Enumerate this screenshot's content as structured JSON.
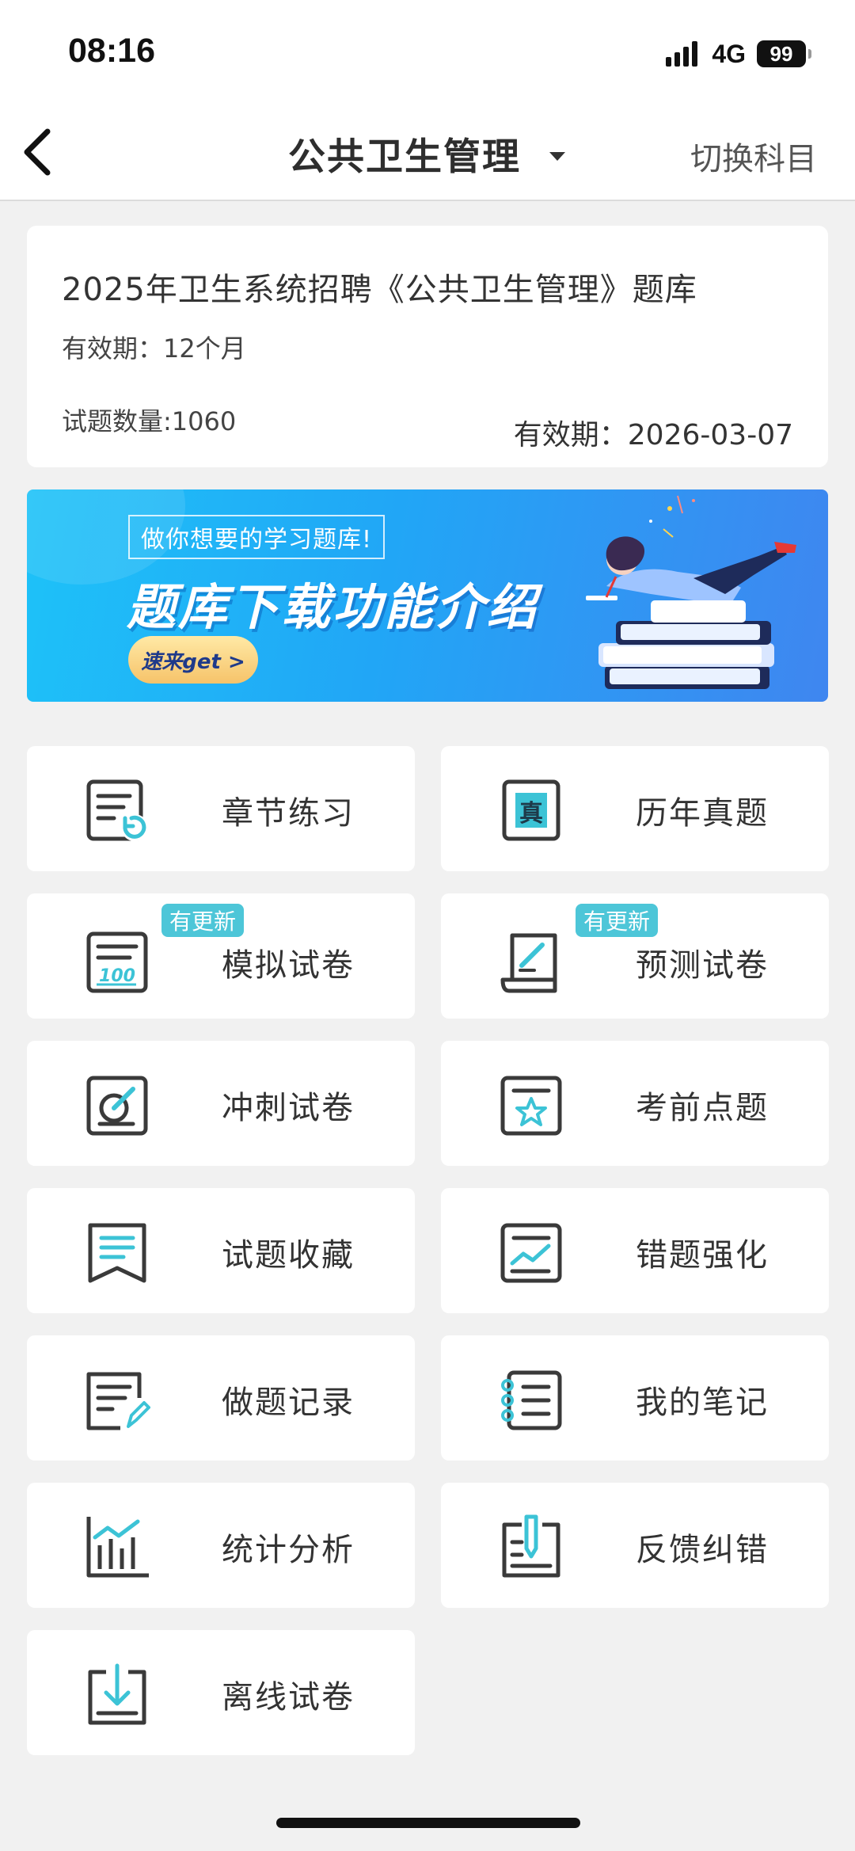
{
  "status": {
    "time": "08:16",
    "network": "4G",
    "battery": "99"
  },
  "nav": {
    "title": "公共卫生管理",
    "switch_label": "切换科目"
  },
  "info": {
    "title": "2025年卫生系统招聘《公共卫生管理》题库",
    "validity": "有效期：12个月",
    "question_count": "试题数量:1060",
    "expire_date": "有效期：2026-03-07"
  },
  "banner": {
    "subtitle": "做你想要的学习题库!",
    "headline": "题库下载功能介绍",
    "button": "速来get >"
  },
  "grid": {
    "badge_label": "有更新",
    "items": [
      {
        "label": "章节练习",
        "icon": "chapter-practice-icon"
      },
      {
        "label": "历年真题",
        "icon": "past-exams-icon"
      },
      {
        "label": "模拟试卷",
        "icon": "mock-paper-icon",
        "badge": true
      },
      {
        "label": "预测试卷",
        "icon": "forecast-paper-icon",
        "badge": true
      },
      {
        "label": "冲刺试卷",
        "icon": "sprint-paper-icon"
      },
      {
        "label": "考前点题",
        "icon": "pre-exam-tips-icon"
      },
      {
        "label": "试题收藏",
        "icon": "bookmark-icon"
      },
      {
        "label": "错题强化",
        "icon": "wrong-questions-icon"
      },
      {
        "label": "做题记录",
        "icon": "practice-record-icon"
      },
      {
        "label": "我的笔记",
        "icon": "notes-icon"
      },
      {
        "label": "统计分析",
        "icon": "statistics-icon"
      },
      {
        "label": "反馈纠错",
        "icon": "feedback-icon"
      },
      {
        "label": "离线试卷",
        "icon": "offline-download-icon"
      }
    ]
  },
  "colors": {
    "accent": "#3cc3d6",
    "icon_stroke": "#3a3a3a",
    "badge": "#4dc6d8"
  }
}
